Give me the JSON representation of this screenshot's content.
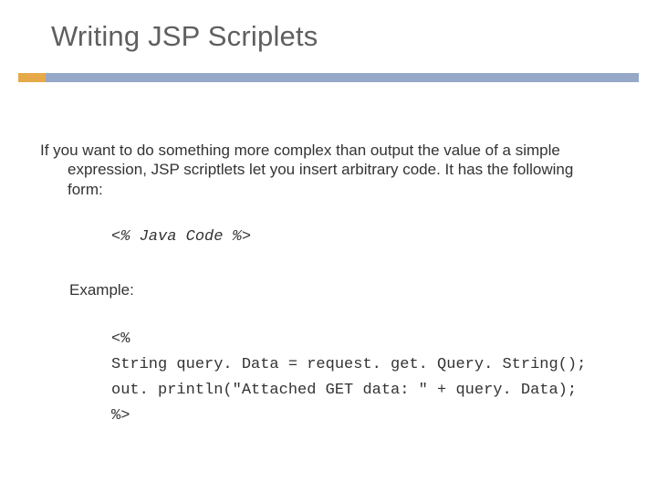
{
  "title": "Writing JSP Scriplets",
  "body": {
    "line1": "If you want to do something more complex than output the value of a simple",
    "line2": "expression, JSP scriptlets let you insert arbitrary code. It has the following",
    "line3": "form:"
  },
  "code_form": "<% Java Code %>",
  "example_label": "Example:",
  "code_block": {
    "line1": "<%",
    "line2": "String query. Data = request. get. Query. String();",
    "line3": "out. println(\"Attached GET data: \" + query. Data);",
    "line4": "%>"
  }
}
